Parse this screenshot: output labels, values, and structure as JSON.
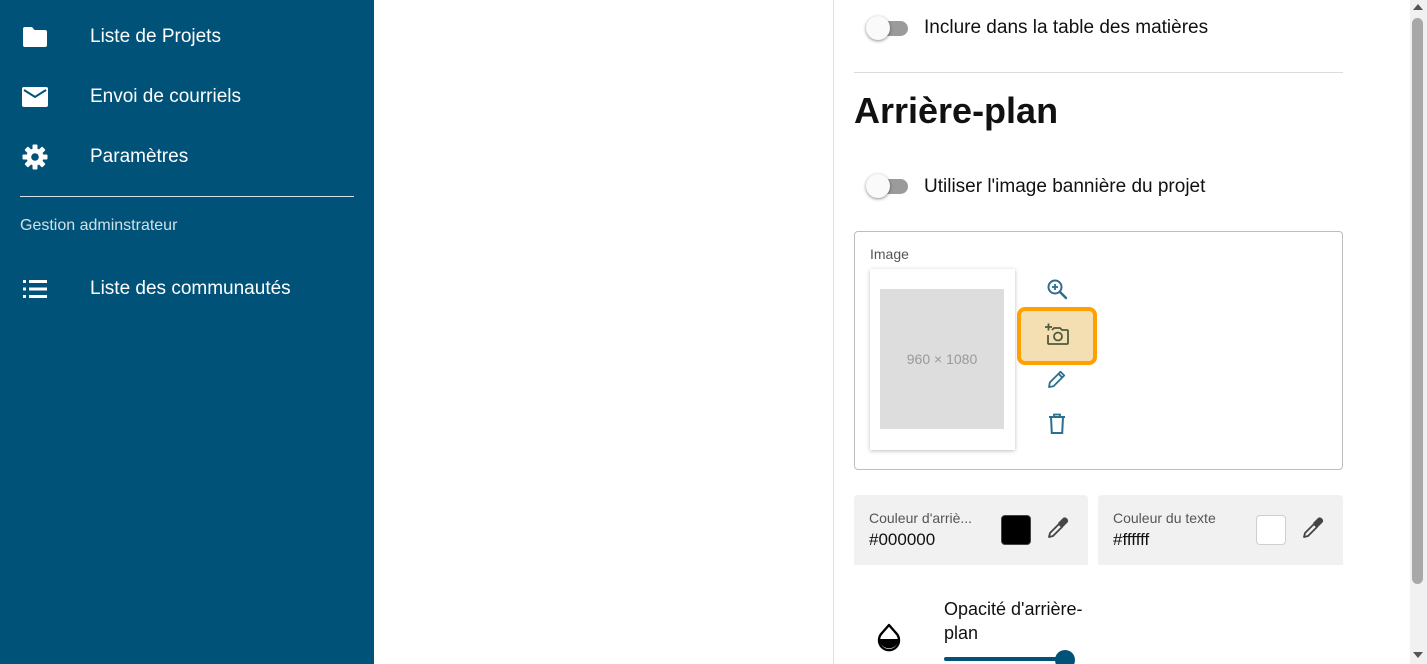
{
  "sidebar": {
    "items": [
      {
        "label": "Liste de Projets",
        "icon": "folder-icon"
      },
      {
        "label": "Envoi de courriels",
        "icon": "mail-icon"
      },
      {
        "label": "Paramètres",
        "icon": "gear-icon"
      }
    ],
    "section_label": "Gestion adminstrateur",
    "admin_items": [
      {
        "label": "Liste des communautés",
        "icon": "list-icon"
      }
    ],
    "colors": {
      "background": "#005278",
      "text": "#ffffff"
    }
  },
  "panel": {
    "toc_toggle_label": "Inclure dans la table des matières",
    "background_title": "Arrière-plan",
    "banner_toggle_label": "Utiliser l'image bannière du projet",
    "image": {
      "label": "Image",
      "placeholder": "960 × 1080",
      "actions": [
        "zoom-in-icon",
        "add-photo-icon",
        "pencil-icon",
        "trash-icon"
      ]
    },
    "bg_color": {
      "label": "Couleur d'arriè...",
      "value": "#000000"
    },
    "text_color": {
      "label": "Couleur du texte",
      "value": "#ffffff"
    },
    "opacity": {
      "label": "Opacité d'arrière-plan",
      "value_percent": 100
    },
    "colors": {
      "accent": "#005278",
      "highlight_border": "#ffa000",
      "highlight_fill": "#f4dfb2",
      "icon": "#2c6f8f"
    }
  }
}
